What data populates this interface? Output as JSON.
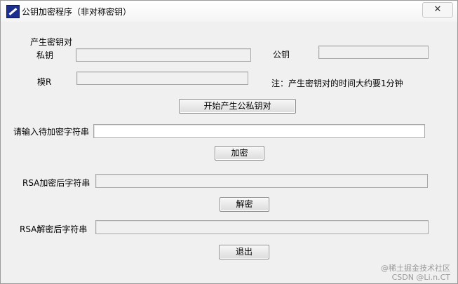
{
  "window": {
    "title": "公钥加密程序（非对称密钥）",
    "close_glyph": "✕"
  },
  "keygen": {
    "group_label": "产生密钥对",
    "private_key_label": "私钥",
    "private_key_value": "",
    "public_key_label": "公钥",
    "public_key_value": "",
    "modulus_label": "模R",
    "modulus_value": "",
    "note": "注：产生密钥对的时间大约要1分钟",
    "generate_button": "开始产生公私钥对"
  },
  "encrypt": {
    "input_label": "请输入待加密字符串",
    "input_value": "",
    "encrypt_button": "加密",
    "result_label": "RSA加密后字符串",
    "result_value": ""
  },
  "decrypt": {
    "decrypt_button": "解密",
    "result_label": "RSA解密后字符串",
    "result_value": ""
  },
  "exit_button": "退出",
  "watermark": {
    "line1": "@稀土掘金技术社区",
    "line2": "CSDN @Li.n.CT"
  }
}
